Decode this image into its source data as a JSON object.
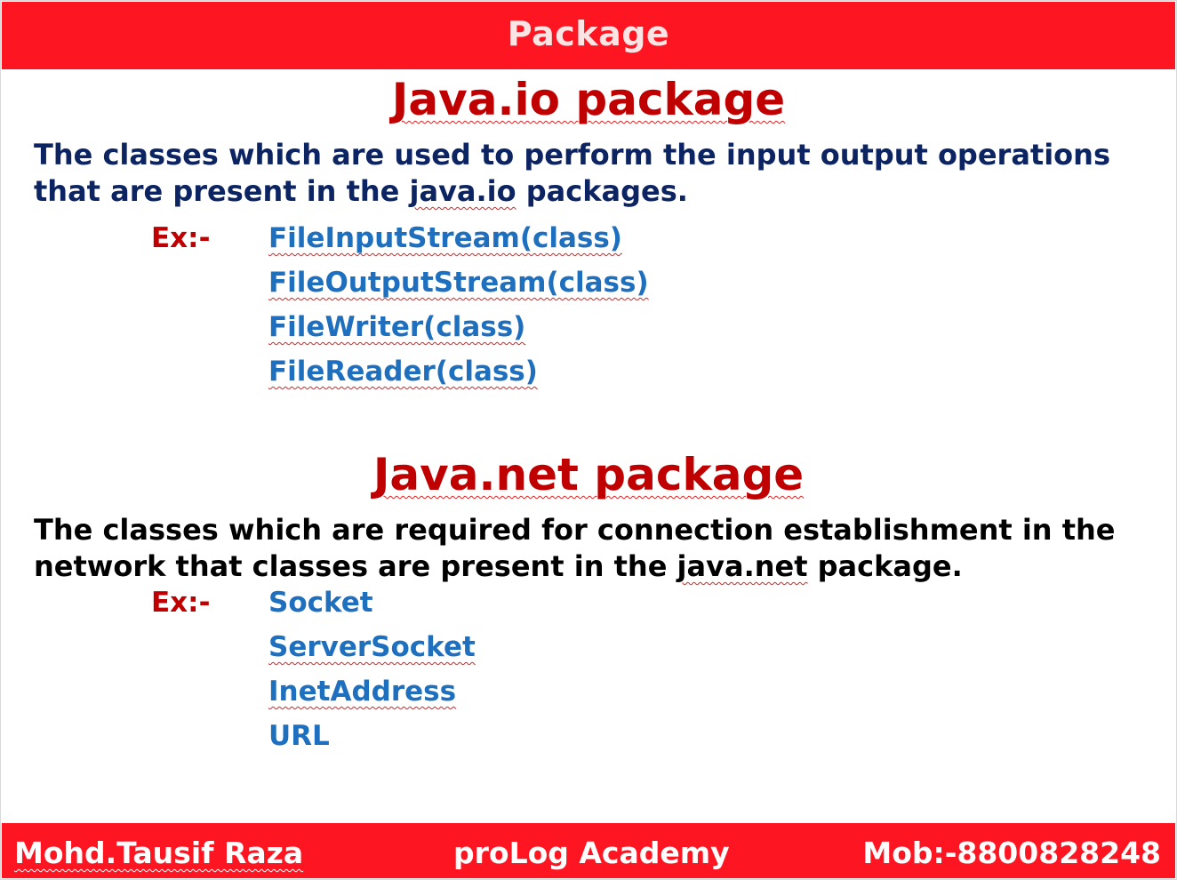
{
  "header": {
    "title": "Package"
  },
  "sections": [
    {
      "heading": "Java.io package",
      "description_pre": "The classes which are used to perform the input output operations that are present in the ",
      "description_code": "java.io",
      "description_post": " packages.",
      "example_label": "Ex:-",
      "examples": [
        "FileInputStream(class)",
        "FileOutputStream(class)",
        "FileWriter(class)",
        "FileReader(class)"
      ]
    },
    {
      "heading": "Java.net package",
      "description_pre": "The classes which are required for connection establishment in the network that classes are present in the ",
      "description_code": "java.net",
      "description_post": " package.",
      "example_label": "Ex:-",
      "examples": [
        "Socket",
        "ServerSocket",
        "InetAddress",
        "URL"
      ]
    }
  ],
  "footer": {
    "author": "Mohd.Tausif Raza",
    "academy": "proLog Academy",
    "mobile": "Mob:-8800828248"
  },
  "colors": {
    "bar": "#fd1521",
    "heading": "#c00000",
    "io_text": "#0d2463",
    "net_text": "#000000",
    "link_blue": "#1f6fbf"
  }
}
